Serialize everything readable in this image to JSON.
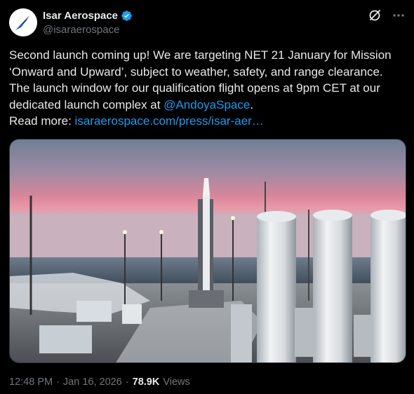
{
  "author": {
    "display_name": "Isar Aerospace",
    "handle": "@isaraerospace",
    "verified": true
  },
  "tweet": {
    "text_main": "Second launch coming up! We are targeting NET 21 January for Mission ‘Onward and Upward’, subject to weather, safety, and range clearance. The launch window for our qualification flight opens at 9pm CET at our dedicated launch complex at ",
    "mention": "@AndoyaSpace",
    "text_after_mention": ".",
    "read_more_label": "Read more: ",
    "link": "isaraerospace.com/press/isar-aer…"
  },
  "media": {
    "icon": "launch-site-photo"
  },
  "meta": {
    "time": "12:48 PM",
    "separator": "·",
    "date": "Jan 16, 2026",
    "views_count": "78.9K",
    "views_label": "Views"
  },
  "icons": {
    "grok": "grok-icon",
    "more": "more-options-icon"
  },
  "colors": {
    "accent": "#1d9bf0",
    "background": "#000000",
    "text": "#e7e9ea",
    "secondary": "#71767b"
  }
}
